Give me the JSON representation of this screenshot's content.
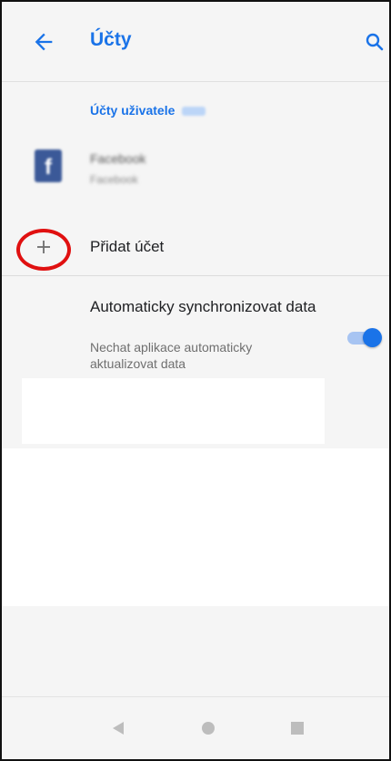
{
  "header": {
    "title": "Účty",
    "back_icon": "arrow-left-icon",
    "search_icon": "search-icon"
  },
  "accounts_section": {
    "header": "Účty uživatele",
    "user_name": "Jiří",
    "items": [
      {
        "name": "Facebook",
        "type": "Facebook",
        "icon": "facebook-icon"
      }
    ]
  },
  "add_account": {
    "label": "Přidat účet",
    "icon": "plus-icon"
  },
  "auto_sync": {
    "title": "Automaticky synchronizovat data",
    "subtitle": "Nechat aplikace automaticky aktualizovat data",
    "enabled": true
  },
  "colors": {
    "accent": "#1a73e8",
    "highlight_circle": "#e01010"
  },
  "navbar": {
    "back_icon": "nav-back-triangle-icon",
    "home_icon": "nav-home-circle-icon",
    "recents_icon": "nav-recents-square-icon"
  }
}
